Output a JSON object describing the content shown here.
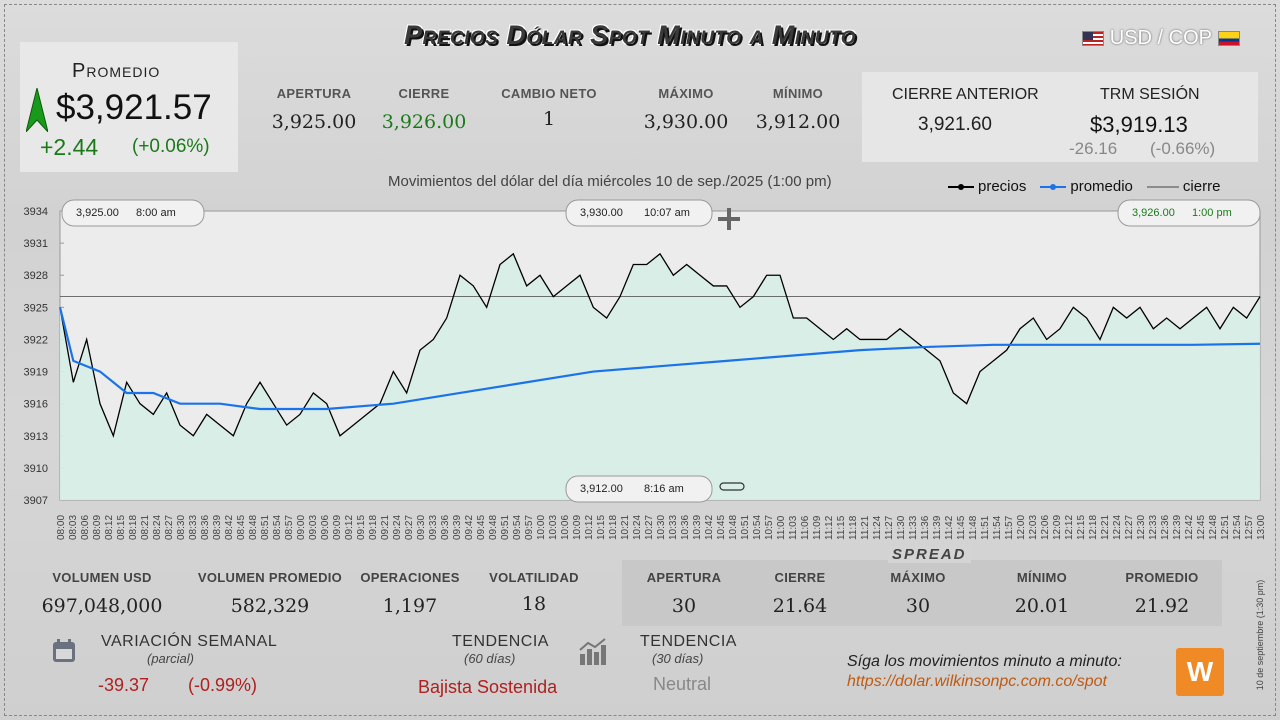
{
  "title": "Precios Dólar Spot Minuto a Minuto",
  "pair": "USD / COP",
  "promedio": {
    "label": "Promedio",
    "value": "$3,921.57",
    "change": "+2.44",
    "change_pct": "(+0.06%)"
  },
  "stats": [
    {
      "label": "APERTURA",
      "value": "3,925.00"
    },
    {
      "label": "CIERRE",
      "value": "3,926.00"
    },
    {
      "label": "CAMBIO NETO",
      "value": "1"
    },
    {
      "label": "MÁXIMO",
      "value": "3,930.00"
    },
    {
      "label": "MÍNIMO",
      "value": "3,912.00"
    }
  ],
  "cierre_anterior": {
    "label": "CIERRE ANTERIOR",
    "value": "3,921.60"
  },
  "trm": {
    "label": "TRM SESIÓN",
    "value": "$3,919.13",
    "change": "-26.16",
    "change_pct": "(-0.66%)"
  },
  "chart_subtitle": "Movimientos del dólar del día miércoles 10 de sep./2025 (1:00 pm)",
  "legend": [
    "precios",
    "promedio",
    "cierre"
  ],
  "callouts": {
    "open": {
      "price": "3,925.00",
      "time": "8:00 am"
    },
    "max": {
      "price": "3,930.00",
      "time": "10:07 am"
    },
    "close": {
      "price": "3,926.00",
      "time": "1:00 pm"
    },
    "min": {
      "price": "3,912.00",
      "time": "8:16 am"
    }
  },
  "colors": {
    "price": "#000000",
    "average": "#1a73e8",
    "close_line": "#444444",
    "area": "#d6eee6",
    "green": "#1a7a1a",
    "red": "#b02020"
  },
  "chart_data": {
    "type": "line",
    "ylim": [
      3907,
      3934
    ],
    "yticks": [
      3934,
      3931,
      3928,
      3925,
      3922,
      3919,
      3916,
      3913,
      3910,
      3907
    ],
    "xticks": [
      "08:00",
      "08:03",
      "08:06",
      "08:09",
      "08:12",
      "08:15",
      "08:18",
      "08:21",
      "08:24",
      "08:27",
      "08:30",
      "08:33",
      "08:36",
      "08:39",
      "08:42",
      "08:45",
      "08:48",
      "08:51",
      "08:54",
      "08:57",
      "09:00",
      "09:03",
      "09:06",
      "09:09",
      "09:12",
      "09:15",
      "09:18",
      "09:21",
      "09:24",
      "09:27",
      "09:30",
      "09:33",
      "09:36",
      "09:39",
      "09:42",
      "09:45",
      "09:48",
      "09:51",
      "09:54",
      "09:57",
      "10:00",
      "10:03",
      "10:06",
      "10:09",
      "10:12",
      "10:15",
      "10:18",
      "10:21",
      "10:24",
      "10:27",
      "10:30",
      "10:33",
      "10:36",
      "10:39",
      "10:42",
      "10:45",
      "10:48",
      "10:51",
      "10:54",
      "10:57",
      "11:00",
      "11:03",
      "11:06",
      "11:09",
      "11:12",
      "11:15",
      "11:18",
      "11:21",
      "11:24",
      "11:27",
      "11:30",
      "11:33",
      "11:36",
      "11:39",
      "11:42",
      "11:45",
      "11:48",
      "11:51",
      "11:54",
      "11:57",
      "12:00",
      "12:03",
      "12:06",
      "12:09",
      "12:12",
      "12:15",
      "12:18",
      "12:21",
      "12:24",
      "12:27",
      "12:30",
      "12:33",
      "12:36",
      "12:39",
      "12:42",
      "12:45",
      "12:48",
      "12:51",
      "12:54",
      "12:57",
      "13:00"
    ],
    "close_level": 3926,
    "series": [
      {
        "name": "precios",
        "x_minutes": [
          0,
          2,
          4,
          6,
          8,
          10,
          12,
          14,
          16,
          18,
          20,
          22,
          24,
          26,
          28,
          30,
          32,
          34,
          36,
          38,
          40,
          42,
          44,
          46,
          48,
          50,
          52,
          54,
          56,
          58,
          60,
          62,
          64,
          66,
          68,
          70,
          72,
          74,
          76,
          78,
          80,
          82,
          84,
          86,
          88,
          90,
          92,
          94,
          96,
          98,
          100,
          102,
          104,
          106,
          108,
          110,
          112,
          114,
          116,
          118,
          120,
          122,
          124,
          126,
          128,
          130,
          132,
          134,
          136,
          138,
          140,
          142,
          144,
          146,
          148,
          150,
          152,
          154,
          156,
          158,
          160,
          162,
          164,
          166,
          168,
          170,
          172,
          174,
          176,
          178,
          180
        ],
        "values": [
          3925,
          3918,
          3922,
          3916,
          3913,
          3918,
          3916,
          3915,
          3917,
          3914,
          3913,
          3915,
          3914,
          3913,
          3916,
          3918,
          3916,
          3914,
          3915,
          3917,
          3916,
          3913,
          3914,
          3915,
          3916,
          3919,
          3917,
          3921,
          3922,
          3924,
          3928,
          3927,
          3925,
          3929,
          3930,
          3927,
          3928,
          3926,
          3927,
          3928,
          3925,
          3924,
          3926,
          3929,
          3929,
          3930,
          3928,
          3929,
          3928,
          3927,
          3927,
          3925,
          3926,
          3928,
          3928,
          3924,
          3924,
          3923,
          3922,
          3923,
          3922,
          3922,
          3922,
          3923,
          3922,
          3921,
          3920,
          3917,
          3916,
          3919,
          3920,
          3921,
          3923,
          3924,
          3922,
          3923,
          3925,
          3924,
          3922,
          3925,
          3924,
          3925,
          3923,
          3924,
          3923,
          3924,
          3925,
          3923,
          3925,
          3924,
          3926
        ]
      },
      {
        "name": "promedio",
        "x_minutes": [
          0,
          2,
          6,
          10,
          14,
          18,
          24,
          30,
          40,
          50,
          60,
          70,
          80,
          90,
          100,
          110,
          120,
          130,
          140,
          150,
          160,
          170,
          180
        ],
        "values": [
          3925,
          3920,
          3919,
          3917,
          3917,
          3916,
          3916,
          3915.5,
          3915.5,
          3916,
          3917,
          3918,
          3919,
          3919.5,
          3920,
          3920.5,
          3921,
          3921.3,
          3921.5,
          3921.5,
          3921.5,
          3921.5,
          3921.6
        ]
      }
    ]
  },
  "bottom_stats": [
    {
      "label": "VOLUMEN USD",
      "value": "697,048,000"
    },
    {
      "label": "VOLUMEN PROMEDIO",
      "value": "582,329"
    },
    {
      "label": "OPERACIONES",
      "value": "1,197"
    },
    {
      "label": "VOLATILIDAD",
      "value": "18"
    }
  ],
  "spread": {
    "title": "SPREAD",
    "items": [
      {
        "label": "APERTURA",
        "value": "30"
      },
      {
        "label": "CIERRE",
        "value": "21.64"
      },
      {
        "label": "MÁXIMO",
        "value": "30"
      },
      {
        "label": "MÍNIMO",
        "value": "20.01"
      },
      {
        "label": "PROMEDIO",
        "value": "21.92"
      }
    ]
  },
  "variacion": {
    "label": "VARIACIÓN SEMANAL",
    "sub": "(parcial)",
    "value": "-39.37",
    "pct": "(-0.99%)"
  },
  "tendencia60": {
    "label": "TENDENCIA",
    "sub": "(60 días)",
    "value": "Bajista Sostenida"
  },
  "tendencia30": {
    "label": "TENDENCIA",
    "sub": "(30 días)",
    "value": "Neutral"
  },
  "follow": {
    "text": "Síga los movimientos minuto a minuto:",
    "url": "https://dolar.wilkinsonpc.com.co/spot"
  },
  "vertical_note": "10 de septiembre (1:30 pm)"
}
